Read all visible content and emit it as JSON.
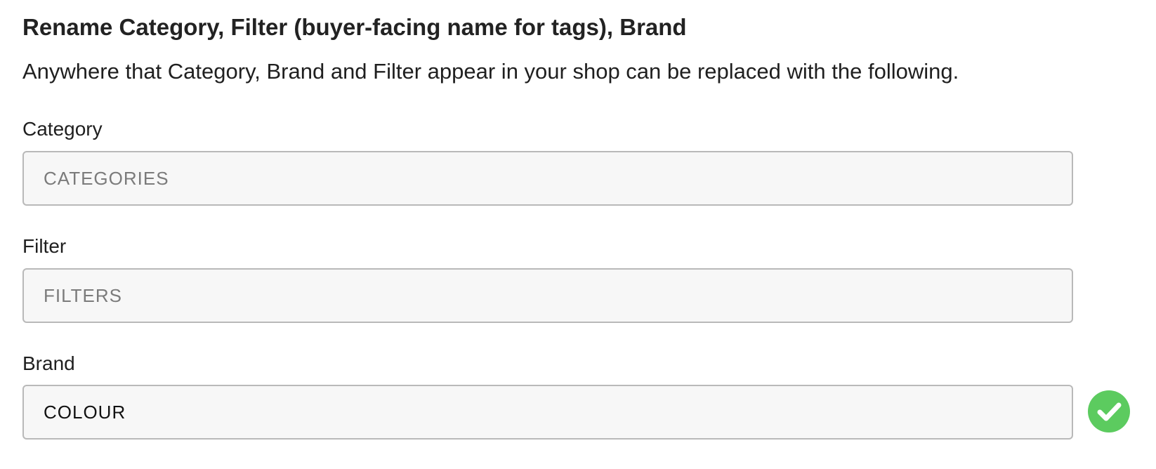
{
  "section": {
    "title": "Rename Category, Filter (buyer-facing name for tags), Brand",
    "description": "Anywhere that Category, Brand and Filter appear in your shop can be replaced with the following."
  },
  "fields": {
    "category": {
      "label": "Category",
      "value": "",
      "placeholder": "CATEGORIES"
    },
    "filter": {
      "label": "Filter",
      "value": "",
      "placeholder": "FILTERS"
    },
    "brand": {
      "label": "Brand",
      "value": "COLOUR",
      "placeholder": ""
    }
  },
  "status": {
    "icon": "check-circle-icon",
    "color": "#5ccb5f"
  }
}
